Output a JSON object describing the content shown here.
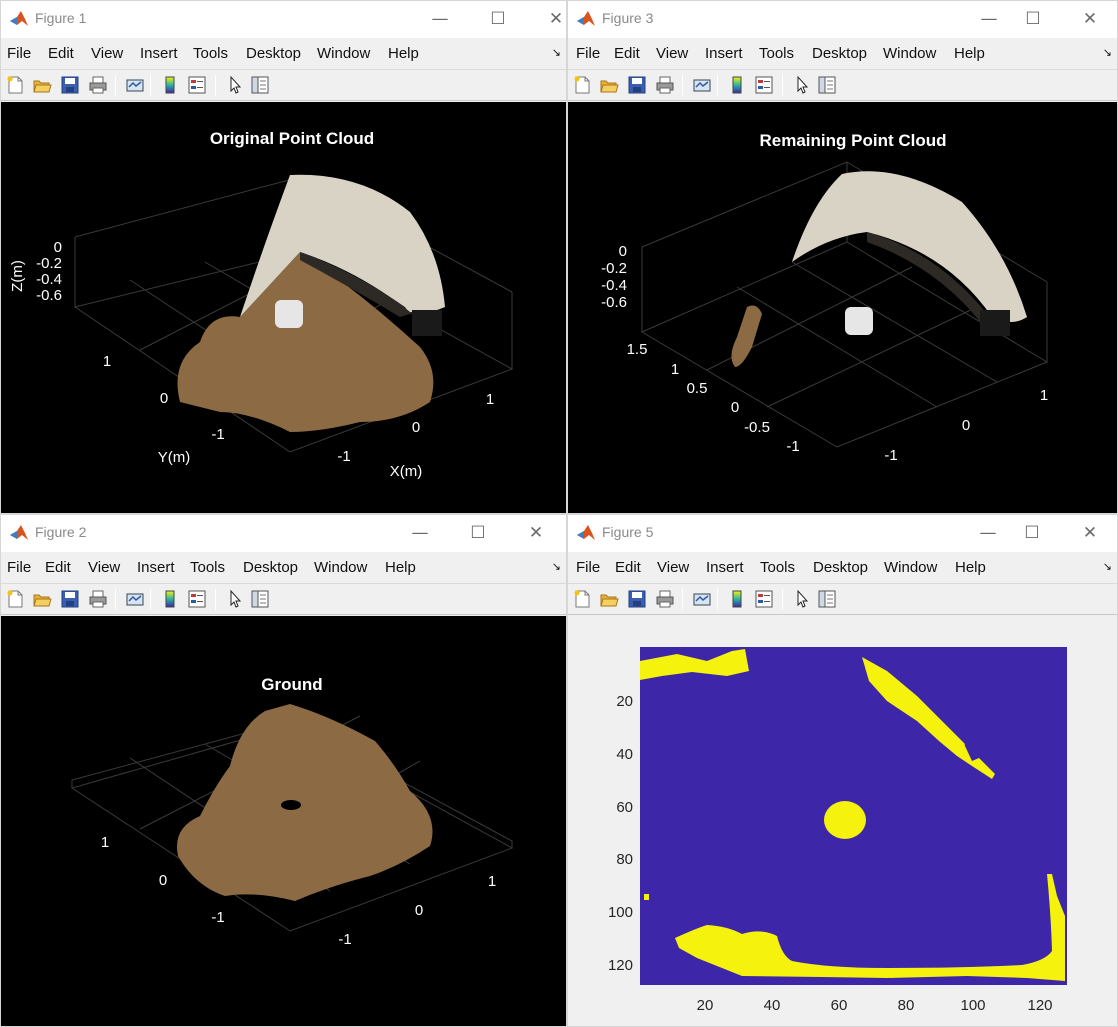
{
  "windows": {
    "fig1": {
      "title": "Figure 1",
      "plot_title": "Original Point Cloud",
      "z_label": "Z(m)",
      "x_label": "X(m)",
      "y_label": "Y(m)",
      "z_ticks": [
        "0",
        "-0.2",
        "-0.4",
        "-0.6"
      ],
      "y_ticks": [
        "1",
        "0",
        "-1"
      ],
      "x_ticks": [
        "1",
        "0",
        "-1"
      ]
    },
    "fig3": {
      "title": "Figure 3",
      "plot_title": "Remaining Point Cloud",
      "z_ticks": [
        "0",
        "-0.2",
        "-0.4",
        "-0.6"
      ],
      "y_ticks": [
        "1.5",
        "1",
        "0.5",
        "0",
        "-0.5",
        "-1"
      ],
      "x_ticks": [
        "1",
        "0",
        "-1"
      ]
    },
    "fig2": {
      "title": "Figure 2",
      "plot_title": "Ground",
      "y_ticks": [
        "1",
        "0",
        "-1"
      ],
      "x_ticks": [
        "1",
        "0",
        "-1"
      ]
    },
    "fig5": {
      "title": "Figure 5",
      "y_ticks": [
        "20",
        "40",
        "60",
        "80",
        "100",
        "120"
      ],
      "x_ticks": [
        "20",
        "40",
        "60",
        "80",
        "100",
        "120"
      ]
    }
  },
  "menu": [
    "File",
    "Edit",
    "View",
    "Insert",
    "Tools",
    "Desktop",
    "Window",
    "Help"
  ],
  "toolbar_icons": [
    "new-figure-icon",
    "open-icon",
    "save-icon",
    "print-icon",
    "link-plot-icon",
    "colorbar-icon",
    "legend-icon",
    "select-pointer-icon",
    "property-editor-icon"
  ],
  "colors": {
    "plot_bg": "#000000",
    "image_bg": "#3e26a8",
    "image_fg": "#f5f20d",
    "floor": "#8b6a44",
    "wall": "#d9d3c6"
  },
  "chart_data": [
    {
      "type": "heatmap",
      "title": "",
      "xlim": [
        0.5,
        128.5
      ],
      "ylim": [
        0.5,
        128.5
      ],
      "xticks": [
        20,
        40,
        60,
        80,
        100,
        120
      ],
      "yticks": [
        20,
        40,
        60,
        80,
        100,
        120
      ],
      "values_description_colors": [
        "#3e26a8",
        "#f5f20d"
      ],
      "regions": [
        {
          "name": "",
          "shape": "blob",
          "center": [
            62,
            66
          ],
          "radius": 6
        },
        {
          "name": "",
          "shape": "band",
          "points": [
            [
              68,
              4
            ],
            [
              80,
              14
            ],
            [
              95,
              32
            ],
            [
              105,
              45
            ]
          ]
        },
        {
          "name": "",
          "shape": "band",
          "points": [
            [
              1,
              8
            ],
            [
              15,
              6
            ],
            [
              30,
              2
            ]
          ]
        },
        {
          "name": "",
          "shape": "band",
          "points": [
            [
              12,
              112
            ],
            [
              25,
              108
            ],
            [
              40,
              115
            ],
            [
              60,
              124
            ],
            [
              100,
              123
            ],
            [
              125,
              120
            ],
            [
              127,
              85
            ]
          ]
        }
      ]
    }
  ]
}
